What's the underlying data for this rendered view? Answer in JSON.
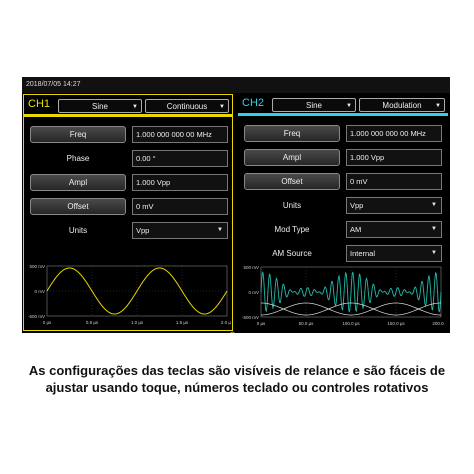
{
  "topbar": {
    "datetime": "2018/07/05 14:27"
  },
  "ch1": {
    "label": "CH1",
    "waveform": "Sine",
    "mode": "Continuous",
    "rows": [
      {
        "kind": "button",
        "label": "Freq",
        "value": "1.000 000 000 00 MHz"
      },
      {
        "kind": "label",
        "label": "Phase",
        "value": "0.00 °"
      },
      {
        "kind": "button",
        "label": "Ampl",
        "value": "1.000 Vpp"
      },
      {
        "kind": "button",
        "label": "Offset",
        "value": "0 mV"
      },
      {
        "kind": "label",
        "label": "Units",
        "value": "Vpp",
        "dropdown": true
      }
    ],
    "plot": {
      "y_ticks": [
        "500 mV",
        "0 mV",
        "-500 mV"
      ],
      "x_ticks": [
        "0 µs",
        "0.5 µs",
        "1.0 µs",
        "1.5 µs",
        "2.0 µs"
      ]
    }
  },
  "ch2": {
    "label": "CH2",
    "waveform": "Sine",
    "mode": "Modulation",
    "rows": [
      {
        "kind": "button",
        "label": "Freq",
        "value": "1.000 000 000 00 MHz"
      },
      {
        "kind": "button",
        "label": "Ampl",
        "value": "1.000 Vpp"
      },
      {
        "kind": "button",
        "label": "Offset",
        "value": "0 mV"
      },
      {
        "kind": "label",
        "label": "Units",
        "value": "Vpp",
        "dropdown": true
      },
      {
        "kind": "label",
        "label": "Mod Type",
        "value": "AM",
        "dropdown": true
      },
      {
        "kind": "label",
        "label": "AM Source",
        "value": "Internal",
        "dropdown": true
      }
    ],
    "plot": {
      "y_ticks": [
        "500 mV",
        "0 mV",
        "-500 mV"
      ],
      "x_ticks": [
        "0 µs",
        "50.0 µs",
        "100.0 µs",
        "150.0 µs",
        "200.0 µs"
      ]
    }
  },
  "caption": {
    "line1": "As configurações das teclas são visíveis de relance e são fáceis de",
    "line2": "ajustar usando toque, números teclado ou controles rotativos"
  },
  "colors": {
    "ch1": "#e6d800",
    "ch2": "#2fd0e8",
    "ch2_wave": "#22b8a8"
  },
  "icons": {
    "dropdown": "triangle-down-icon",
    "expand": "chevron-up-icon"
  }
}
